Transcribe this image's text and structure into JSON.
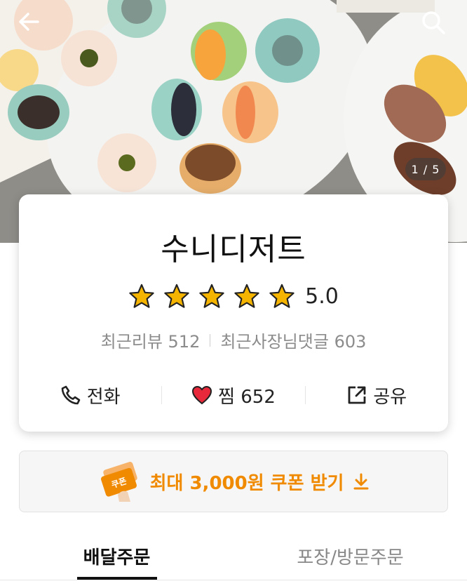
{
  "header": {
    "back_icon": "back-arrow-icon",
    "search_icon": "search-icon",
    "image_counter": "1 / 5"
  },
  "store": {
    "name": "수니디저트",
    "rating": "5.0",
    "rating_stars": 5,
    "recent_reviews_label": "최근리뷰 512",
    "recent_owner_replies_label": "최근사장님댓글 603"
  },
  "actions": {
    "call_label": "전화",
    "like_label": "찜 652",
    "share_label": "공유"
  },
  "coupon": {
    "label": "최대 3,000원 쿠폰 받기",
    "ticket_text": "쿠폰"
  },
  "tabs": [
    {
      "label": "배달주문",
      "active": true
    },
    {
      "label": "포장/방문주문",
      "active": false
    }
  ],
  "colors": {
    "accent": "#f08a00",
    "star": "#f5b400",
    "heart": "#e8293b"
  }
}
